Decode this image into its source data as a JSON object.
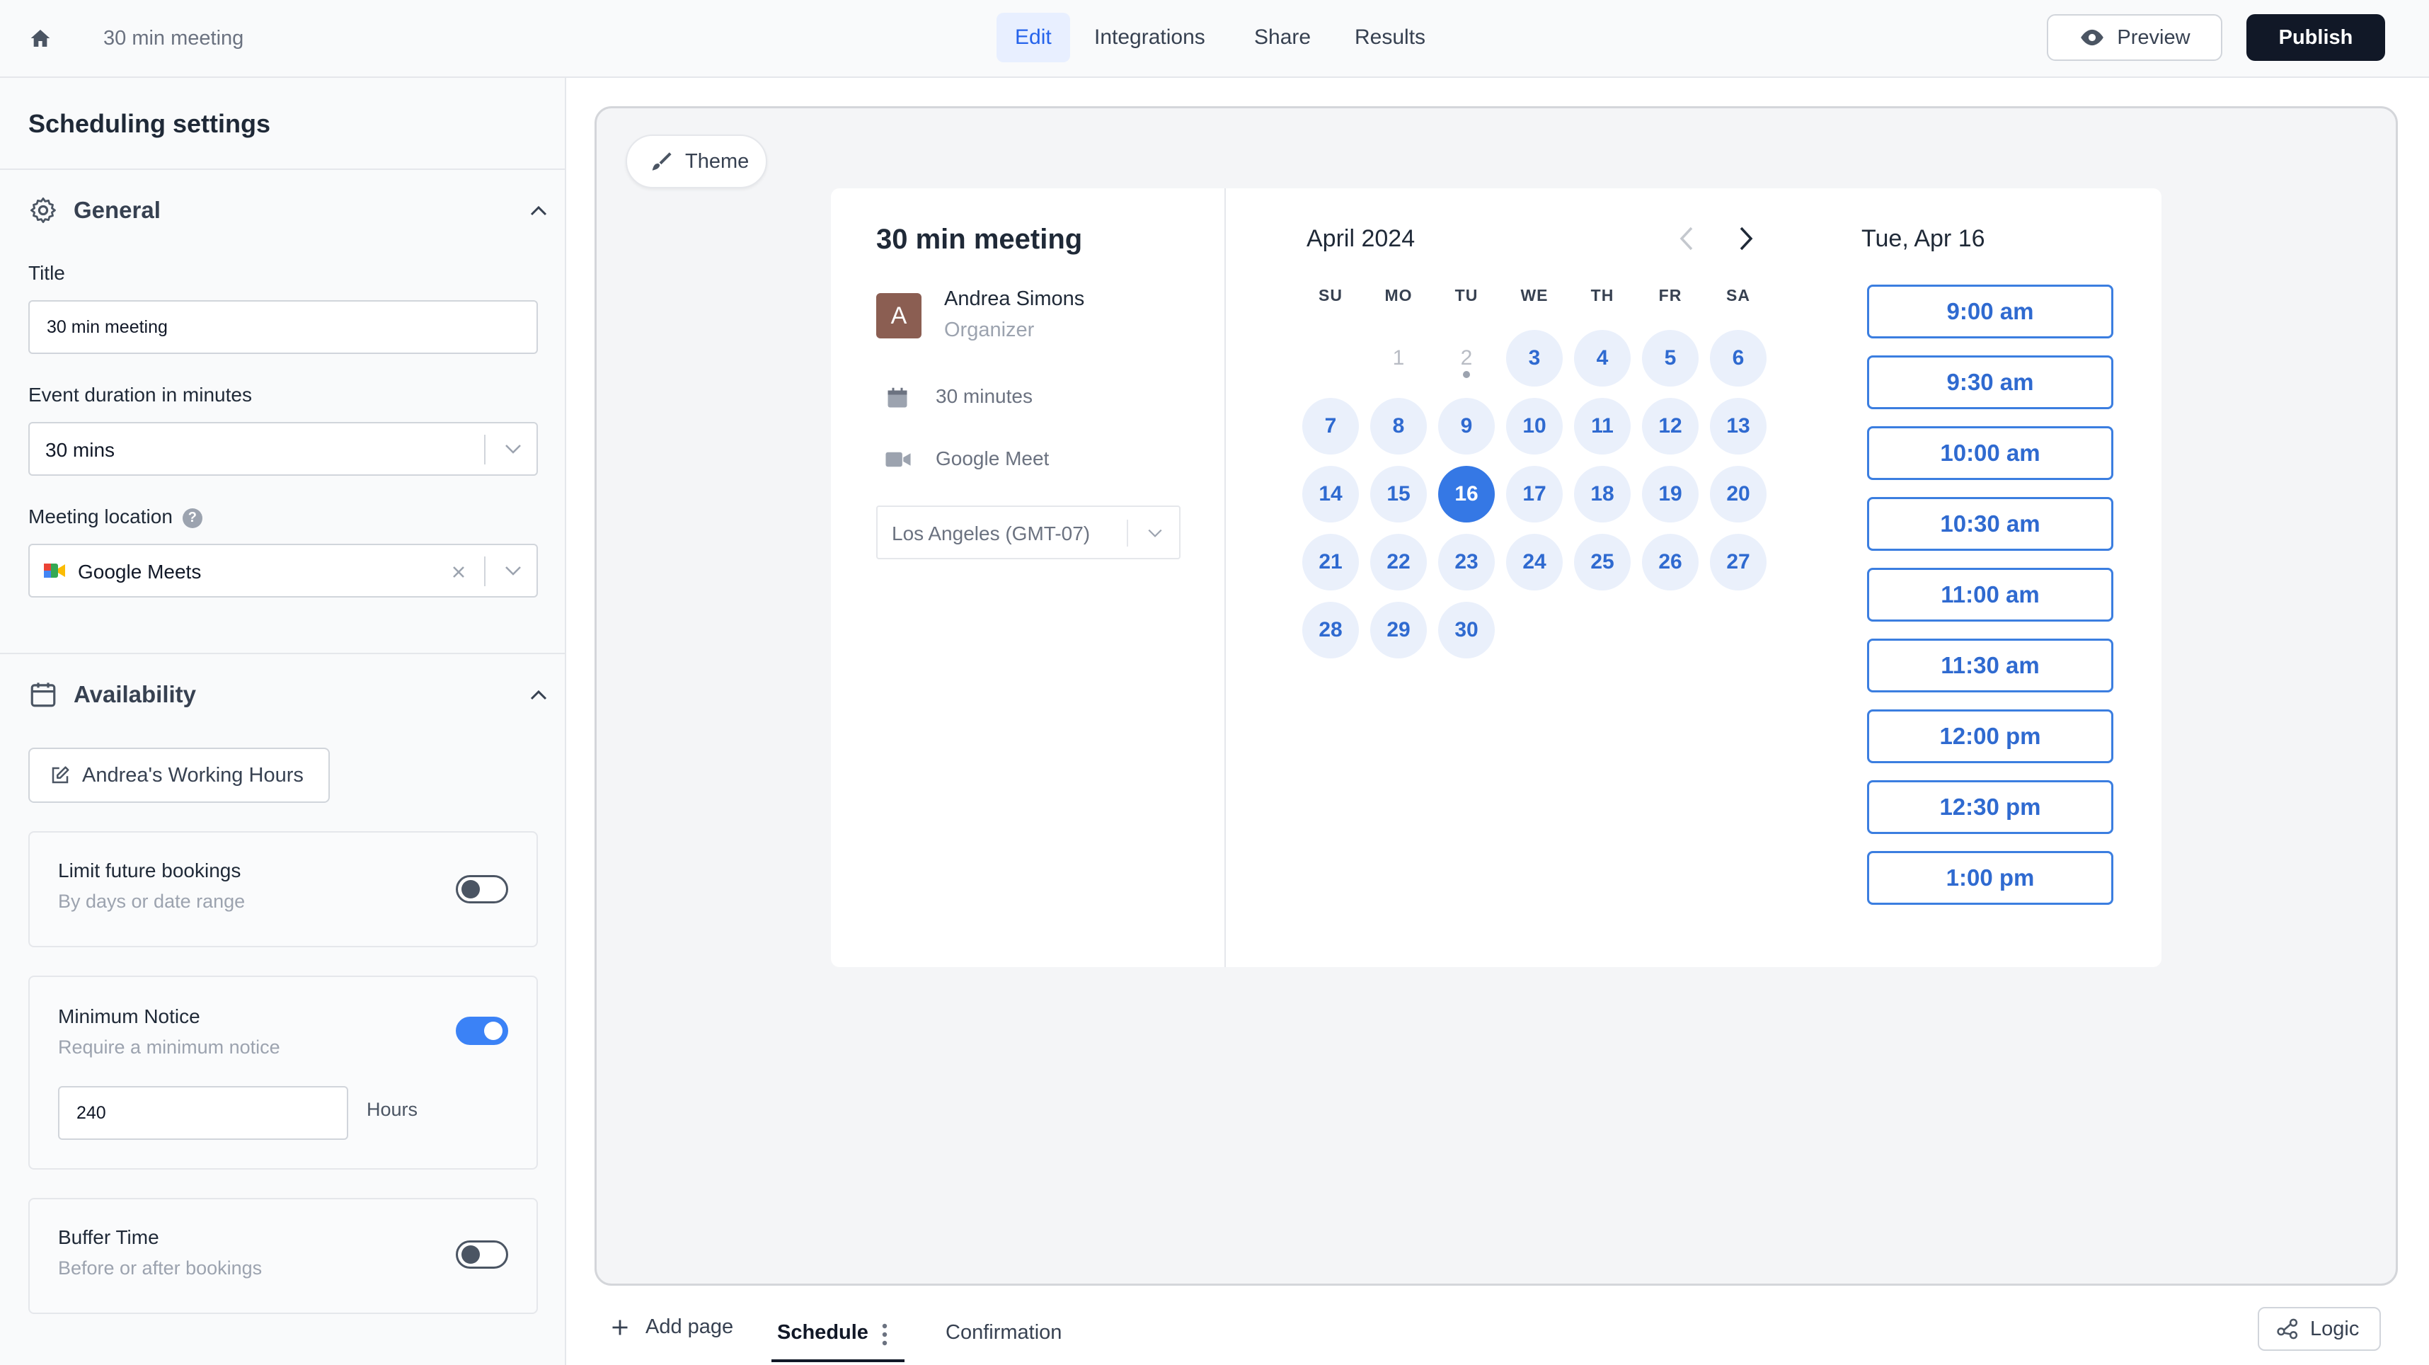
{
  "header": {
    "breadcrumb": "30 min meeting",
    "tabs": {
      "edit": "Edit",
      "integrations": "Integrations",
      "share": "Share",
      "results": "Results"
    },
    "preview_label": "Preview",
    "publish_label": "Publish"
  },
  "sidebar": {
    "title": "Scheduling settings",
    "general": {
      "heading": "General",
      "title_label": "Title",
      "title_value": "30 min meeting",
      "duration_label": "Event duration in minutes",
      "duration_value": "30 mins",
      "location_label": "Meeting location",
      "location_value": "Google Meets"
    },
    "availability": {
      "heading": "Availability",
      "working_hours_label": "Andrea's Working Hours",
      "limit_future": {
        "title": "Limit future bookings",
        "subtitle": "By days or date range",
        "enabled": false
      },
      "minimum_notice": {
        "title": "Minimum Notice",
        "subtitle": "Require a minimum notice",
        "enabled": true,
        "value": "240",
        "unit": "Hours"
      },
      "buffer_time": {
        "title": "Buffer Time",
        "subtitle": "Before or after bookings",
        "enabled": false
      }
    }
  },
  "canvas": {
    "theme_label": "Theme",
    "meeting": {
      "title": "30 min meeting",
      "avatar_initial": "A",
      "organizer_name": "Andrea Simons",
      "organizer_role": "Organizer",
      "duration": "30 minutes",
      "platform": "Google Meet",
      "timezone": "Los Angeles (GMT-07)"
    },
    "calendar": {
      "month": "April 2024",
      "weekdays": [
        "SU",
        "MO",
        "TU",
        "WE",
        "TH",
        "FR",
        "SA"
      ],
      "first_weekday_index": 1,
      "days_in_month": 30,
      "disabled_days": [
        1,
        2
      ],
      "today": 2,
      "selected_day": 16
    },
    "selected_date": "Tue, Apr 16",
    "time_slots": [
      "9:00 am",
      "9:30 am",
      "10:00 am",
      "10:30 am",
      "11:00 am",
      "11:30 am",
      "12:00 pm",
      "12:30 pm",
      "1:00 pm"
    ]
  },
  "pages": {
    "add_page_label": "Add page",
    "tabs": [
      "Schedule",
      "Confirmation"
    ],
    "active": "Schedule",
    "logic_label": "Logic"
  },
  "colors": {
    "accent": "#3578e5",
    "publish_bg": "#111827",
    "day_bg": "#eaf0fb"
  }
}
